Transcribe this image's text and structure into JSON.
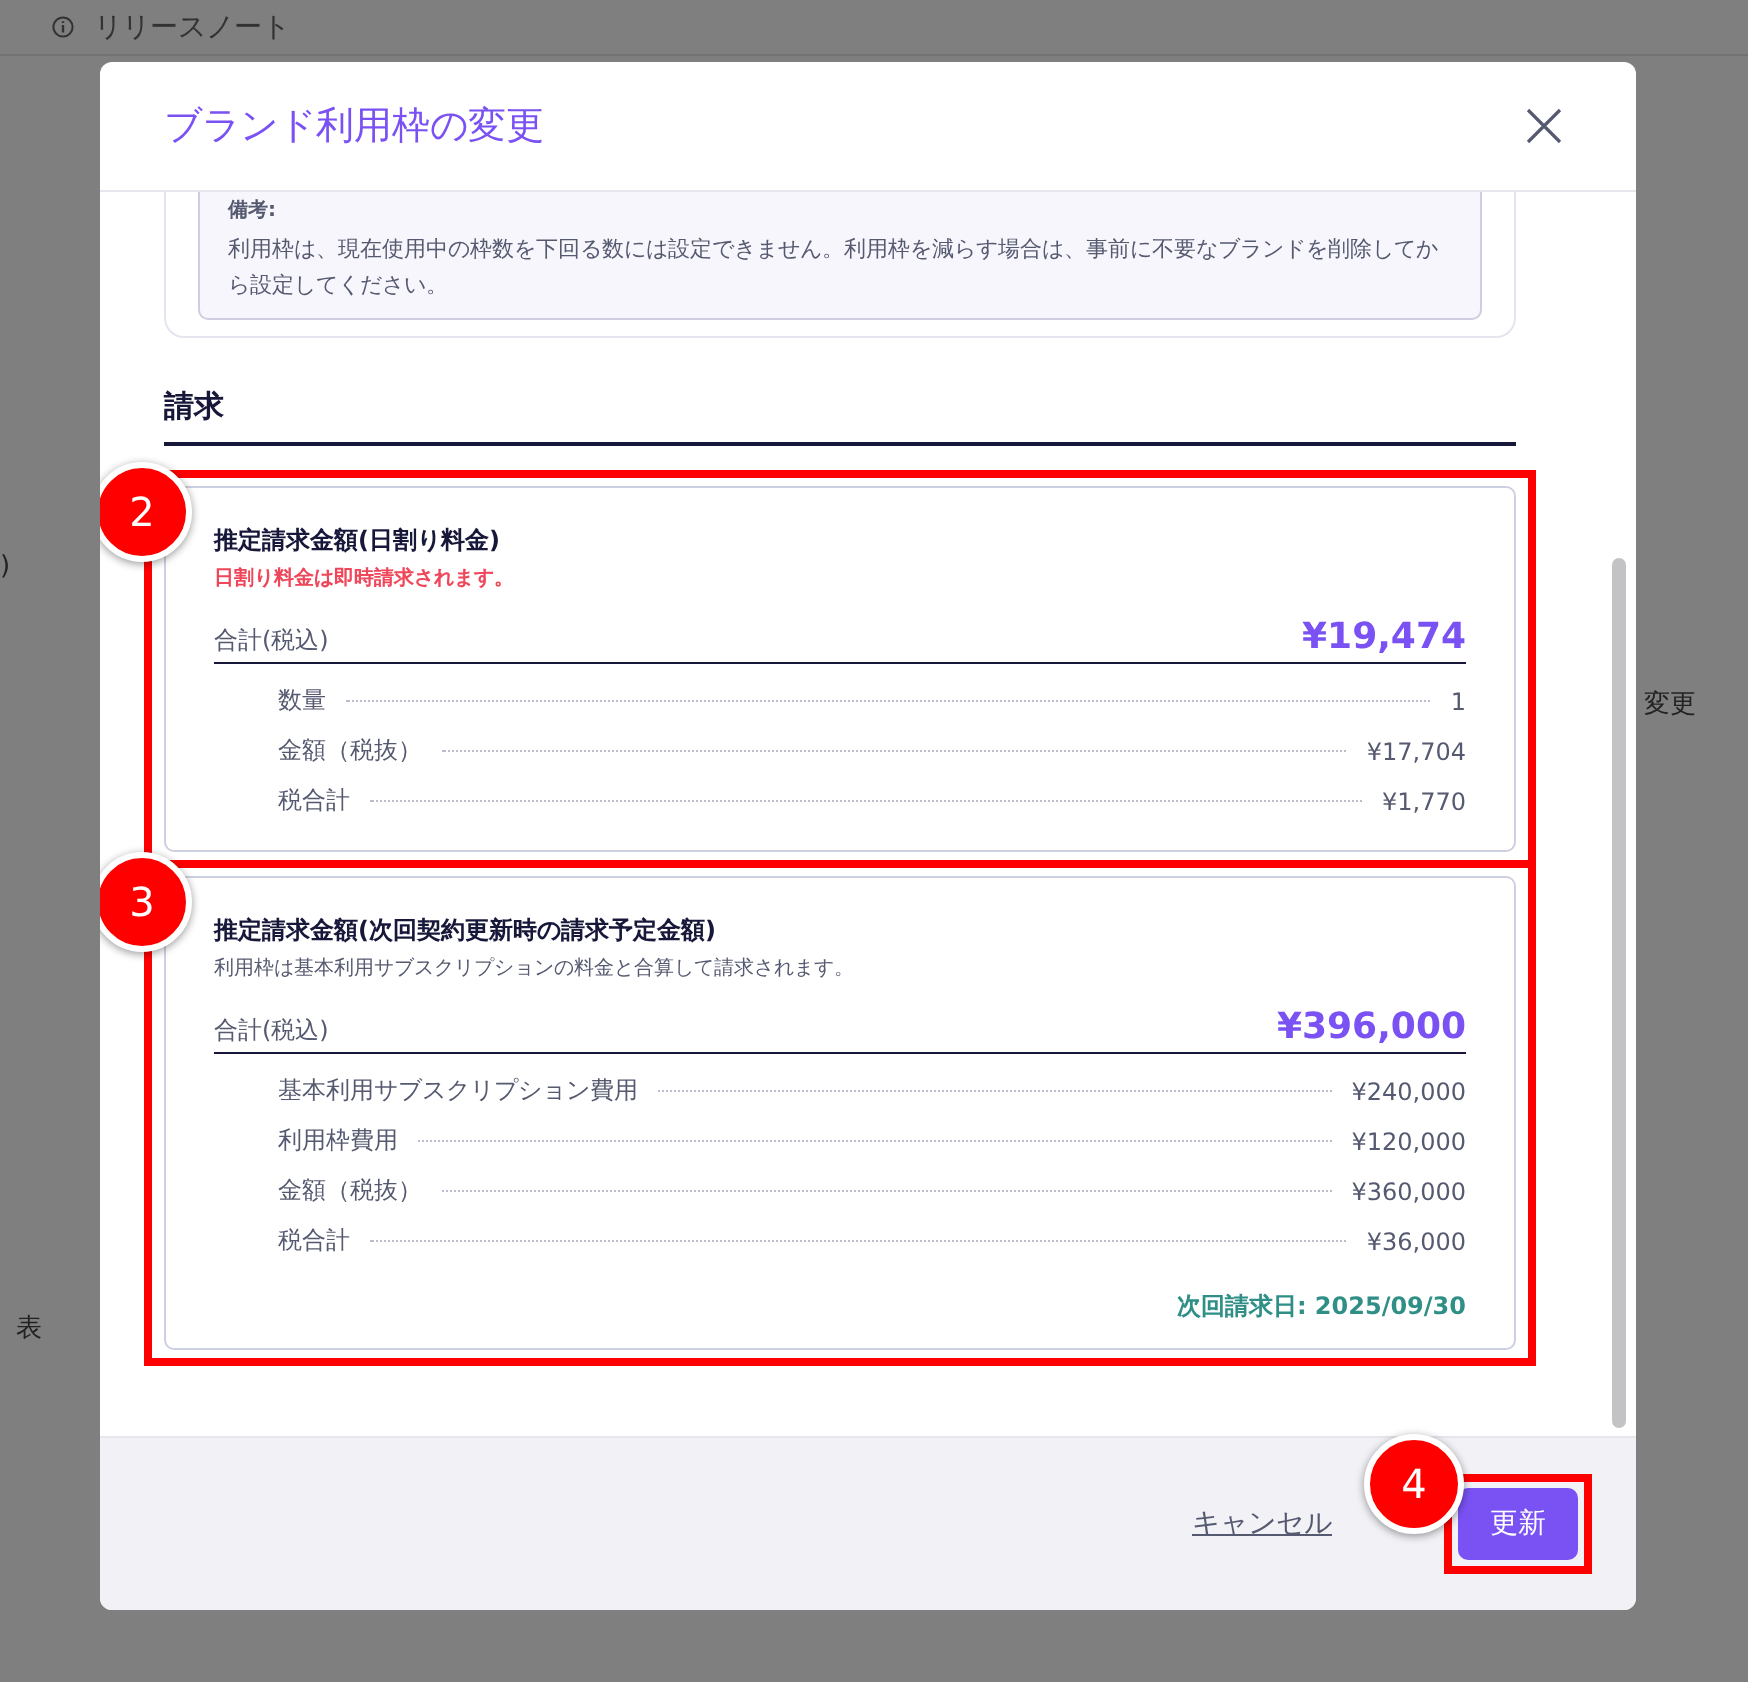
{
  "background": {
    "header_item": "リリースノート",
    "fragments": [
      {
        "text": ")",
        "kind": "left"
      },
      {
        "text": "表",
        "kind": "lower"
      },
      {
        "text": "変更",
        "kind": "right"
      }
    ]
  },
  "dialog": {
    "title": "ブランド利用枠の変更",
    "note": {
      "label": "備考:",
      "text": "利用枠は、現在使用中の枠数を下回る数には設定できません。利用枠を減らす場合は、事前に不要なブランドを削除してから設定してください。"
    },
    "section_title": "請求",
    "estimates": [
      {
        "marker": "2",
        "title": "推定請求金額(日割り料金)",
        "subtitle": "日割り料金は即時請求されます。",
        "kind": "warning",
        "total_label": "合計(税込)",
        "total": "¥19,474",
        "lines": [
          {
            "label": "数量",
            "value": "1"
          },
          {
            "label": "金額（税抜）",
            "value": "¥17,704"
          },
          {
            "label": "税合計",
            "value": "¥1,770"
          }
        ]
      },
      {
        "marker": "3",
        "title": "推定請求金額(次回契約更新時の請求予定金額)",
        "subtitle": "利用枠は基本利用サブスクリプションの料金と合算して請求されます。",
        "kind": "info",
        "total_label": "合計(税込)",
        "total": "¥396,000",
        "lines": [
          {
            "label": "基本利用サブスクリプション費用",
            "value": "¥240,000"
          },
          {
            "label": "利用枠費用",
            "value": "¥120,000"
          },
          {
            "label": "金額（税抜）",
            "value": "¥360,000"
          },
          {
            "label": "税合計",
            "value": "¥36,000"
          }
        ],
        "next_billing": "次回請求日: 2025/09/30"
      }
    ],
    "cancel": "キャンセル",
    "submit": {
      "label": "更新",
      "marker": "4"
    }
  }
}
